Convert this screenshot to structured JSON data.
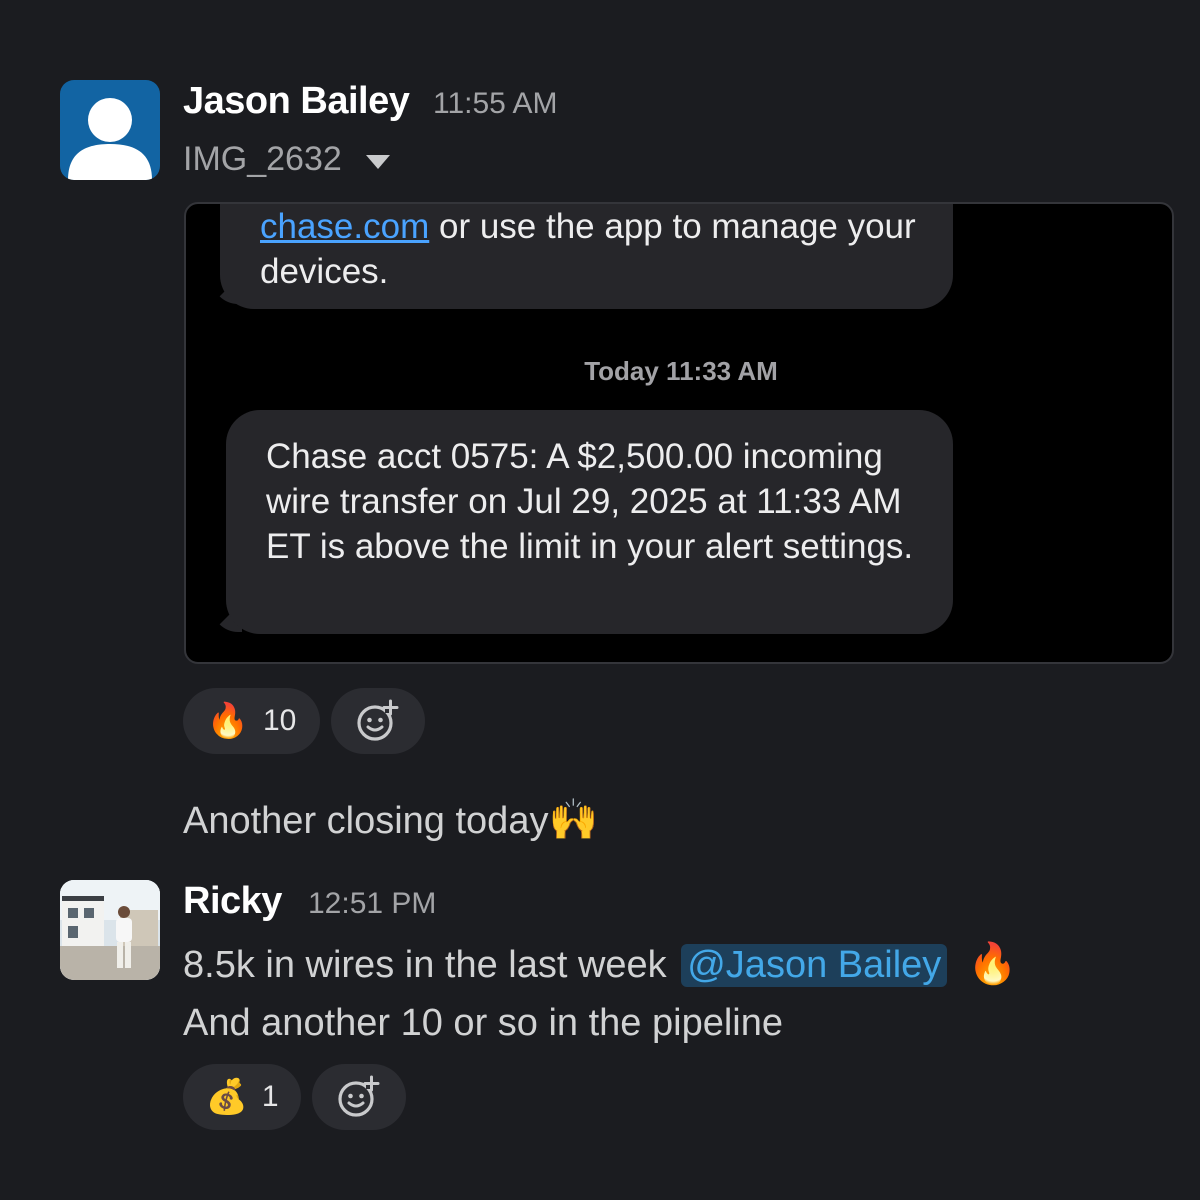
{
  "messages": [
    {
      "sender": "Jason Bailey",
      "time": "11:55 AM",
      "file_name": "IMG_2632",
      "attachment": {
        "top_bubble_link": "chase.com",
        "top_bubble_text": " or use the app to manage your devices.",
        "sms_timestamp": "Today 11:33 AM",
        "main_bubble_text": "Chase acct 0575: A $2,500.00 incoming wire transfer on Jul 29, 2025 at 11:33 AM ET is above the limit in your alert settings."
      },
      "reactions": [
        {
          "emoji": "🔥",
          "count": "10"
        }
      ],
      "followup_text": "Another closing today",
      "followup_emoji": "🙌"
    },
    {
      "sender": "Ricky",
      "time": "12:51 PM",
      "line1_text": "8.5k in wires in the last week",
      "line1_mention": "@Jason Bailey",
      "line1_emoji": "🔥",
      "line2_text": "And another 10 or so in the pipeline",
      "reactions": [
        {
          "emoji": "💰",
          "count": "1"
        }
      ]
    }
  ],
  "icons": {
    "add_reaction": "add-reaction-icon",
    "caret": "chevron-down-icon"
  }
}
